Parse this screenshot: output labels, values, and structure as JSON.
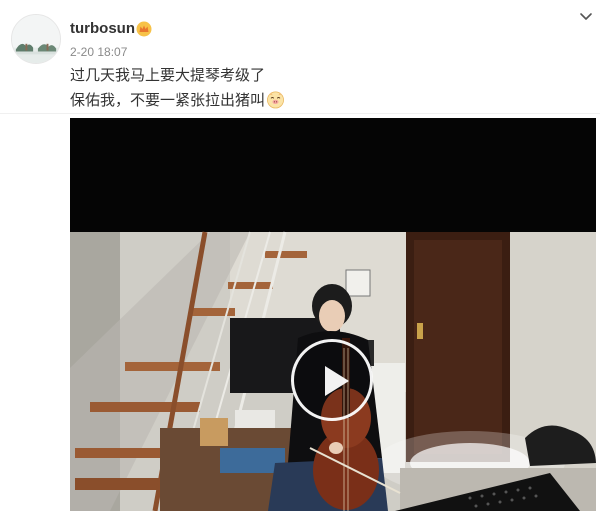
{
  "post": {
    "username": "turbosun",
    "timestamp": "2-20 18:07",
    "text_lines": [
      "过几天我马上要大提琴考级了",
      "保佑我，不要一紧张拉出猪叫"
    ],
    "icons": {
      "verified_badge": "vip-crown-icon",
      "more_menu": "chevron-down-icon",
      "emoji": "pig-face-emoji-icon",
      "play": "play-icon"
    },
    "colors": {
      "username": "#333333",
      "timestamp": "#8a8a8a",
      "badge": "#f5a623",
      "video_bg": "#050505"
    }
  }
}
